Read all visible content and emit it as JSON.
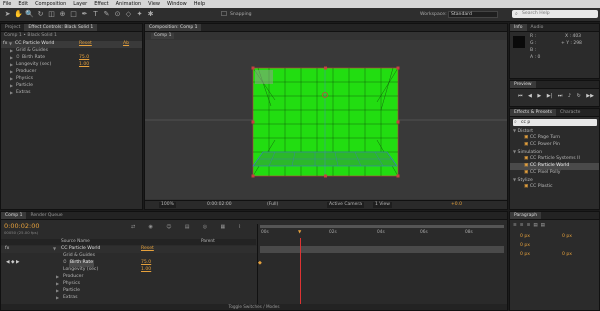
{
  "menu": [
    "File",
    "Edit",
    "Composition",
    "Layer",
    "Effect",
    "Animation",
    "View",
    "Window",
    "Help"
  ],
  "toolbar": {
    "snapping_label": "Snapping",
    "workspace_label": "Workspace:",
    "workspace_value": "Standard",
    "search_placeholder": "Search Help"
  },
  "project_panel": {
    "tabs": [
      "Project",
      "Effect Controls: Black Solid 1"
    ],
    "breadcrumb": "Comp 1 • Black Solid 1",
    "effect_name": "CC Particle World",
    "reset_label": "Reset",
    "about_label": "Ab",
    "rows": [
      {
        "label": "Grid & Guides",
        "value": ""
      },
      {
        "label": "Birth Rate",
        "value": "75.0"
      },
      {
        "label": "Longevity (sec)",
        "value": "1.00"
      },
      {
        "label": "Producer",
        "value": ""
      },
      {
        "label": "Physics",
        "value": ""
      },
      {
        "label": "Particle",
        "value": ""
      },
      {
        "label": "Extras",
        "value": ""
      }
    ]
  },
  "composition": {
    "tab": "Composition: Comp 1",
    "sub_tab": "Comp 1",
    "zoom": "100%",
    "timecode": "0:00:02:00",
    "resolution": "(Full)",
    "camera": "Active Camera",
    "view": "1 View",
    "exposure": "+0.0"
  },
  "info_panel": {
    "tabs": [
      "Info",
      "Audio"
    ],
    "r_label": "R :",
    "g_label": "G :",
    "b_label": "B :",
    "a_label": "A : 0",
    "x_label": "X : 403",
    "y_label": "+ Y : 298"
  },
  "preview_panel": {
    "title": "Preview"
  },
  "effects_panel": {
    "tabs": [
      "Effects & Presets",
      "Characte"
    ],
    "search_value": "cc p",
    "groups": [
      {
        "name": "Distort",
        "items": [
          "CC Page Turn",
          "CC Power Pin"
        ]
      },
      {
        "name": "Simulation",
        "items": [
          "CC Particle Systems II",
          "CC Particle World",
          "CC Pixel Polly"
        ]
      },
      {
        "name": "Stylize",
        "items": [
          "CC Plastic"
        ]
      }
    ]
  },
  "paragraph_panel": {
    "title": "Paragraph",
    "fields": [
      "0 px",
      "0 px",
      "0 px",
      "0 px",
      "0 px"
    ]
  },
  "timeline": {
    "tabs": [
      "Comp 1",
      "Render Queue"
    ],
    "timecode": "0:00:02:00",
    "frames": "00050 (25.00 fps)",
    "col_source": "Source Name",
    "col_parent": "Parent",
    "rows": [
      {
        "label": "CC Particle World",
        "value": "Reset"
      },
      {
        "label": "Grid & Guides",
        "value": ""
      },
      {
        "label": "Birth Rate",
        "value": "75.0"
      },
      {
        "label": "Longevity (sec)",
        "value": "1.00"
      },
      {
        "label": "Producer",
        "value": ""
      },
      {
        "label": "Physics",
        "value": ""
      },
      {
        "label": "Particle",
        "value": ""
      },
      {
        "label": "Extras",
        "value": ""
      }
    ],
    "ruler": [
      "00s",
      "02s",
      "04s",
      "06s",
      "08s"
    ],
    "footer": "Toggle Switches / Modes"
  }
}
